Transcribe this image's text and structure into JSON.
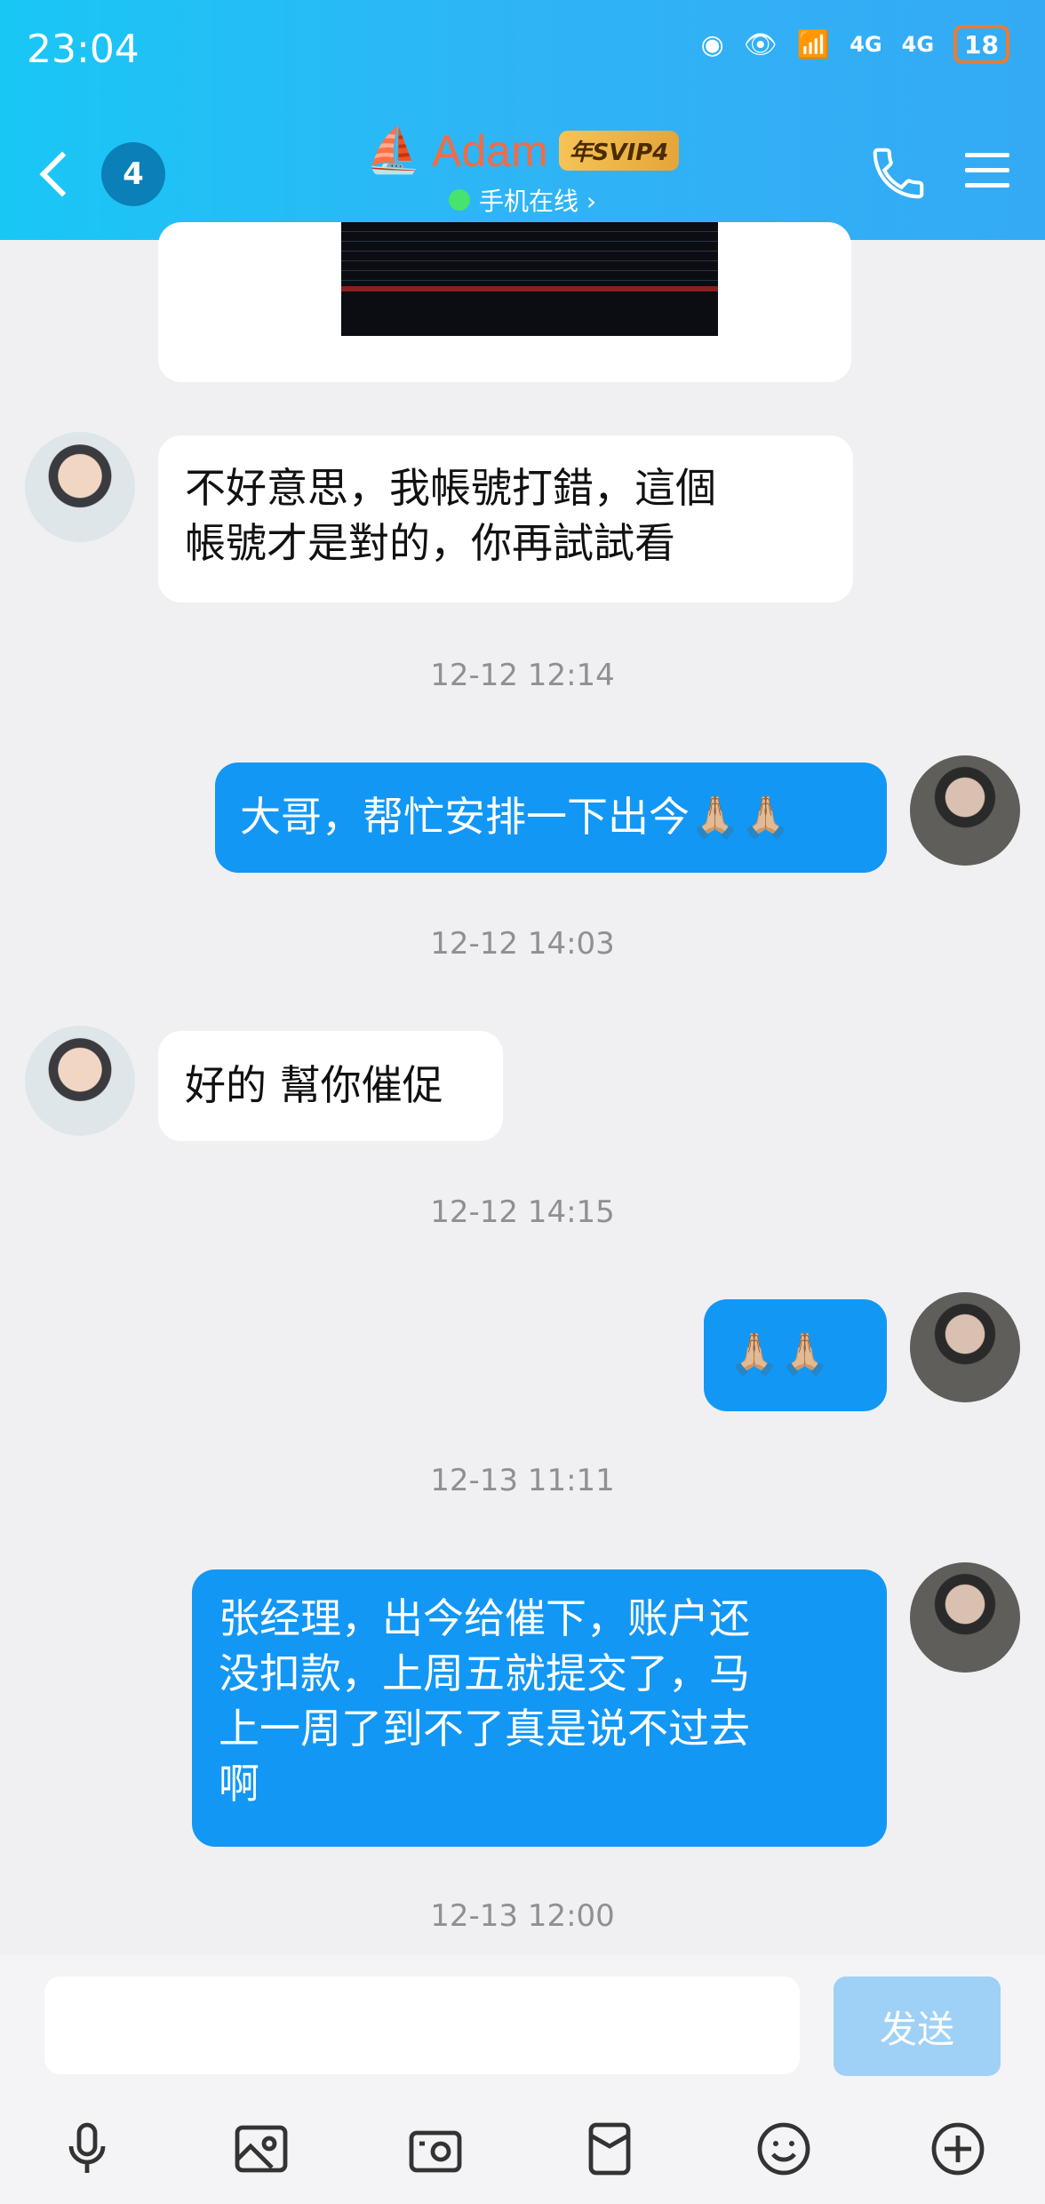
{
  "status_bar": {
    "time": "23:04",
    "network1": "4G",
    "network2": "4G",
    "battery": "18"
  },
  "header": {
    "unread_count": "4",
    "contact_name": "Adam",
    "vip_badge": "年SVIP4",
    "online_status": "手机在线 ›"
  },
  "messages": [
    {
      "from": "them",
      "text_line1": "不好意思，我帳號打錯，這個",
      "text_line2": "帳號才是對的，你再試試看"
    },
    {
      "timestamp": "12-12 12:14"
    },
    {
      "from": "me",
      "text": "大哥，帮忙安排一下出今🙏🏼🙏🏼"
    },
    {
      "timestamp": "12-12 14:03"
    },
    {
      "from": "them",
      "text": "好的 幫你催促"
    },
    {
      "timestamp": "12-12 14:15"
    },
    {
      "from": "me",
      "text": "🙏🏼🙏🏼"
    },
    {
      "timestamp": "12-13 11:11"
    },
    {
      "from": "me",
      "text_line1": "张经理，出今给催下，账户还",
      "text_line2": "没扣款，上周五就提交了，马",
      "text_line3": "上一周了到不了真是说不过去",
      "text_line4": "啊"
    },
    {
      "timestamp": "12-13 12:00"
    }
  ],
  "input": {
    "placeholder": "",
    "send_label": "发送"
  },
  "colors": {
    "header": "#2fb4f6",
    "outgoing_bubble": "#1297f5",
    "incoming_bubble": "#ffffff",
    "name": "#f36b43"
  }
}
